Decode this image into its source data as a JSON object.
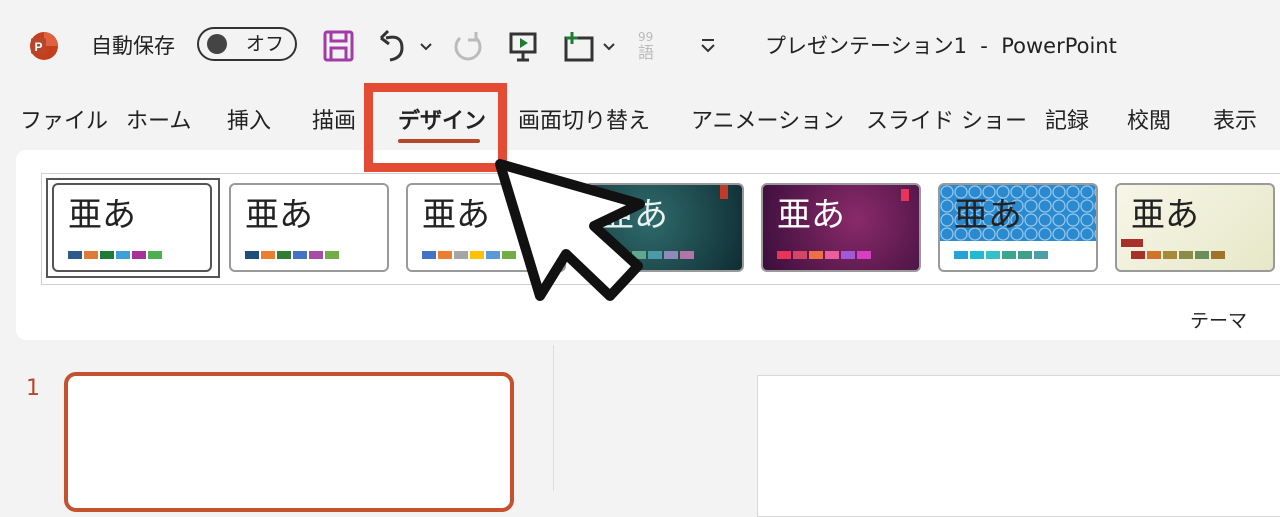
{
  "titlebar": {
    "autosave_label": "自動保存",
    "autosave_state": "オフ",
    "doc_title": "プレゼンテーション1  -  PowerPoint"
  },
  "tabs": [
    {
      "label": "ファイル"
    },
    {
      "label": "ホーム"
    },
    {
      "label": "挿入"
    },
    {
      "label": "描画"
    },
    {
      "label": "デザイン"
    },
    {
      "label": "画面切り替え"
    },
    {
      "label": "アニメーション"
    },
    {
      "label": "スライド ショー"
    },
    {
      "label": "記録"
    },
    {
      "label": "校閲"
    },
    {
      "label": "表示"
    }
  ],
  "active_tab": "デザイン",
  "themes": [
    {
      "text": "亜あ",
      "swatches": [
        "#2e5c8a",
        "#e07b39",
        "#1f7a3a",
        "#3aa0d8",
        "#a6329a",
        "#4caf50"
      ]
    },
    {
      "text": "亜あ",
      "swatches": [
        "#1f4e79",
        "#ed7d31",
        "#2e7d32",
        "#4472c4",
        "#a64ca6",
        "#70ad47"
      ]
    },
    {
      "text": "亜あ",
      "swatches": [
        "#4472c4",
        "#ed7d31",
        "#a5a5a5",
        "#ffc000",
        "#5b9bd5",
        "#70ad47"
      ]
    },
    {
      "text": "亜あ",
      "swatches": [
        "#e8a33d",
        "#d86f3a",
        "#5fa88e",
        "#4c9aa8",
        "#8e8bb8",
        "#b574a9"
      ]
    },
    {
      "text": "亜あ",
      "swatches": [
        "#e8335a",
        "#d64566",
        "#f07045",
        "#e85f9c",
        "#a05ad8",
        "#d83ec2"
      ]
    },
    {
      "text": "亜あ",
      "swatches": [
        "#27a2d8",
        "#1fbad6",
        "#34c0c8",
        "#3ba68f",
        "#3fa08a",
        "#4aa0a6"
      ]
    },
    {
      "text": "亜あ",
      "swatches": [
        "#a8322a",
        "#d0742a",
        "#a58a3a",
        "#8b8b4a",
        "#6a8e5a",
        "#a0722a"
      ]
    }
  ],
  "ribbon_group_label": "テーマ",
  "slides": [
    {
      "number": "1"
    }
  ]
}
